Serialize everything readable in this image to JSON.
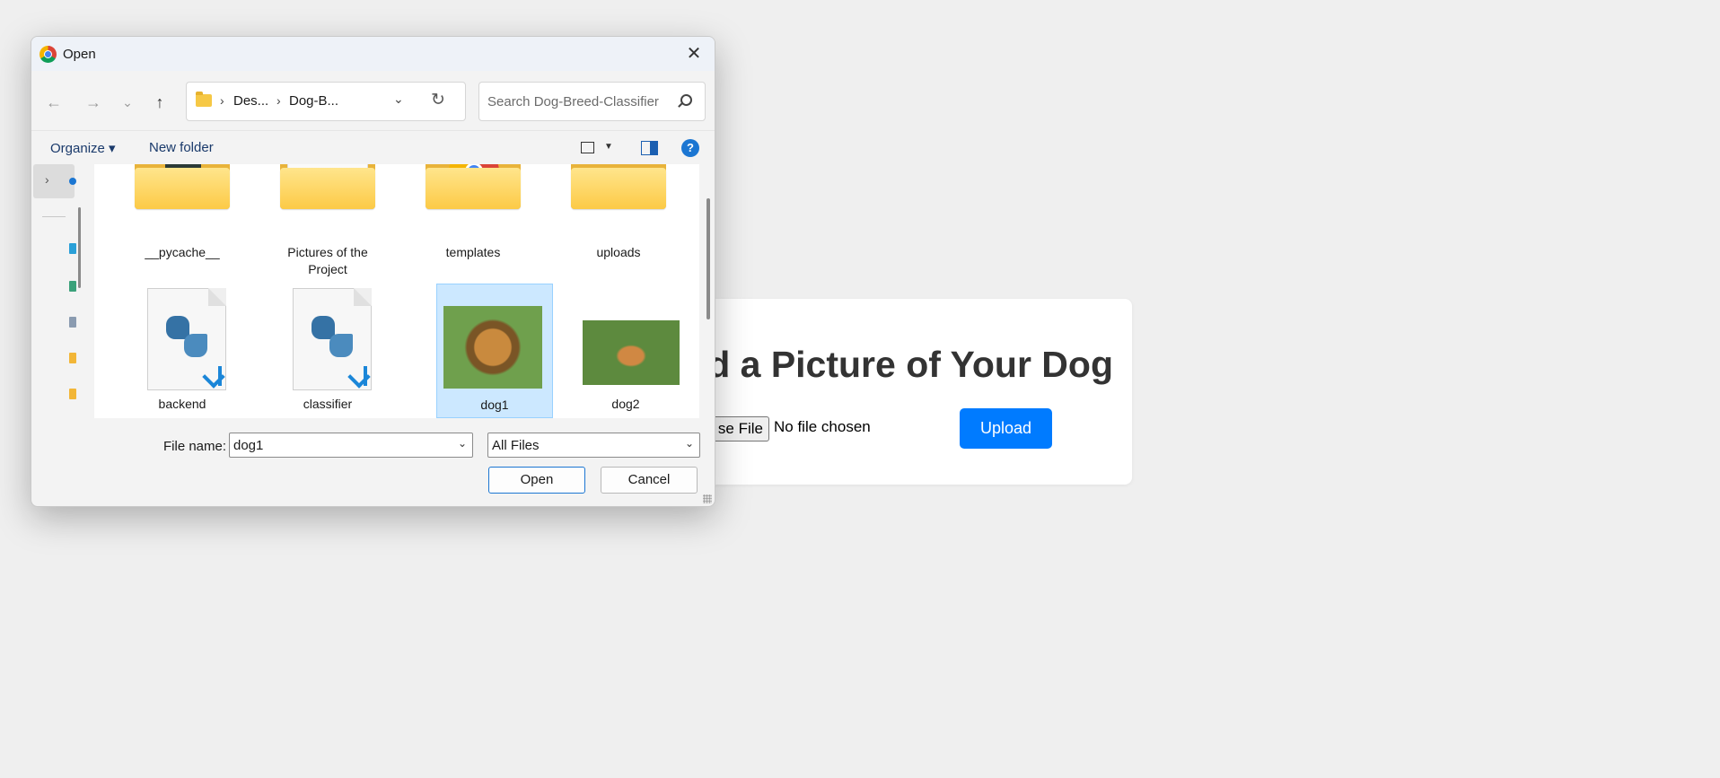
{
  "web_page": {
    "heading": "d a Picture of Your Dog",
    "choose_label": "se File",
    "no_file": "No file chosen",
    "upload_label": "Upload"
  },
  "dialog": {
    "title": "Open",
    "nav": {
      "back": "←",
      "forward": "→",
      "recent": "⌄",
      "up": "↑",
      "close": "✕"
    },
    "address": {
      "segments": [
        "Des...",
        "Dog-B..."
      ],
      "sep": "›",
      "dropdown": "⌄",
      "refresh": "↻"
    },
    "search": {
      "placeholder": "Search Dog-Breed-Classifier"
    },
    "commands": {
      "organize": "Organize ▾",
      "new_folder": "New folder",
      "view_dd": "▼",
      "help": "?"
    },
    "files": [
      {
        "name": "__pycache__",
        "type": "folder",
        "icon": "folder-code-icon"
      },
      {
        "name": "Pictures of the Project",
        "type": "folder",
        "icon": "folder-pictures-icon"
      },
      {
        "name": "templates",
        "type": "folder",
        "icon": "folder-chrome-icon"
      },
      {
        "name": "uploads",
        "type": "folder",
        "icon": "folder-icon"
      },
      {
        "name": "backend",
        "type": "python-file",
        "icon": "python-file-icon"
      },
      {
        "name": "classifier",
        "type": "python-file",
        "icon": "python-file-icon"
      },
      {
        "name": "dog1",
        "type": "image",
        "icon": "image-thumbnail",
        "selected": true
      },
      {
        "name": "dog2",
        "type": "image",
        "icon": "image-thumbnail"
      }
    ],
    "footer": {
      "file_name_label": "File name:",
      "file_name_value": "dog1",
      "file_type_value": "All Files",
      "open_label": "Open",
      "cancel_label": "Cancel",
      "chevron": "⌄"
    }
  },
  "colors": {
    "accent": "#007bff",
    "selection": "#cce8ff",
    "folder": "#fcca46"
  }
}
